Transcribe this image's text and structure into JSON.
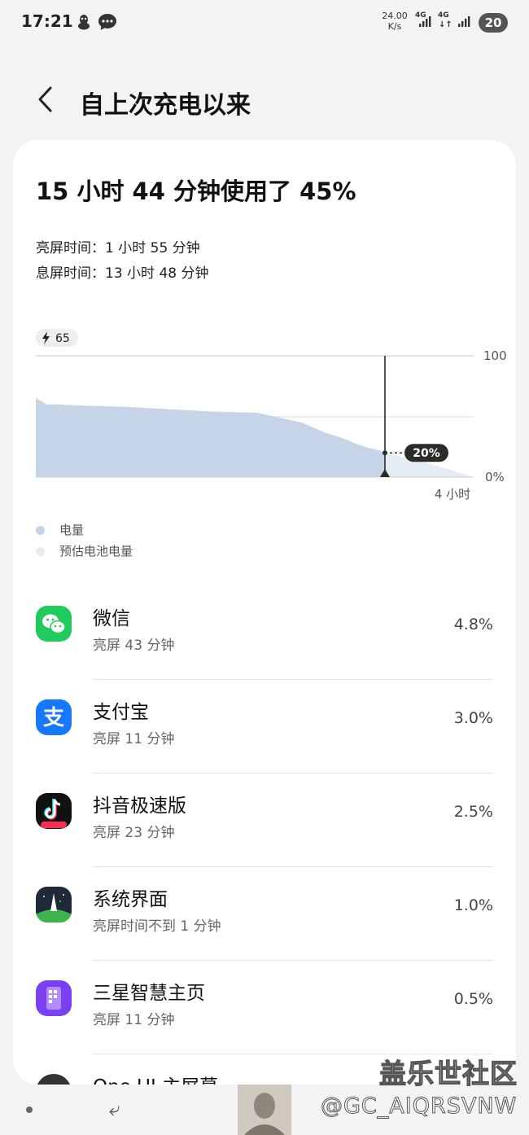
{
  "status_bar": {
    "time": "17:21",
    "speed_value": "24.00",
    "speed_unit": "K/s",
    "network_1": "4G",
    "network_2": "4G",
    "battery": "20"
  },
  "header": {
    "title": "自上次充电以来"
  },
  "summary": {
    "usage_title": "15 小时 44 分钟使用了 45%",
    "screen_on": "亮屏时间：1 小时 55 分钟",
    "screen_off": "息屏时间：13 小时 48 分钟"
  },
  "chart_data": {
    "type": "area",
    "start_badge": "65",
    "y_top_label": "100",
    "y_bottom_label": "0%",
    "ylim": [
      0,
      100
    ],
    "current_marker_label": "20%",
    "x_estimate_label": "4 小时",
    "series": [
      {
        "name": "电量",
        "x": [
          0,
          0.5,
          1,
          2,
          4,
          6,
          8,
          10,
          12,
          13,
          14,
          14.5,
          15,
          15.5,
          15.74
        ],
        "values": [
          65,
          60,
          60,
          59,
          58,
          56,
          54,
          53,
          45,
          37,
          31,
          27,
          24,
          22,
          20
        ]
      },
      {
        "name": "预估电池电量",
        "x": [
          15.74,
          17,
          18.5,
          19.74
        ],
        "values": [
          20,
          15,
          7,
          0
        ]
      }
    ],
    "colors": {
      "actual": "#c5d4e6",
      "estimate": "#e6ecf3",
      "marker": "#2b2b2b"
    }
  },
  "legend": [
    {
      "label": "电量",
      "color": "#c5d4e6"
    },
    {
      "label": "预估电池电量",
      "color": "#e6ecf3"
    }
  ],
  "apps": [
    {
      "name": "微信",
      "detail": "亮屏 43 分钟",
      "percent": "4.8%",
      "icon": "wechat-icon"
    },
    {
      "name": "支付宝",
      "detail": "亮屏 11 分钟",
      "percent": "3.0%",
      "icon": "alipay-icon"
    },
    {
      "name": "抖音极速版",
      "detail": "亮屏 23 分钟",
      "percent": "2.5%",
      "icon": "douyin-lite-icon"
    },
    {
      "name": "系统界面",
      "detail": "亮屏时间不到 1 分钟",
      "percent": "1.0%",
      "icon": "system-ui-icon"
    },
    {
      "name": "三星智慧主页",
      "detail": "亮屏 11 分钟",
      "percent": "0.5%",
      "icon": "samsung-free-icon"
    },
    {
      "name": "One UI 主屏幕",
      "detail": "",
      "percent": "",
      "icon": "one-ui-home-icon"
    }
  ],
  "watermark": {
    "site": "盖乐世社区",
    "user": "@GC_AIQRSVNW"
  }
}
